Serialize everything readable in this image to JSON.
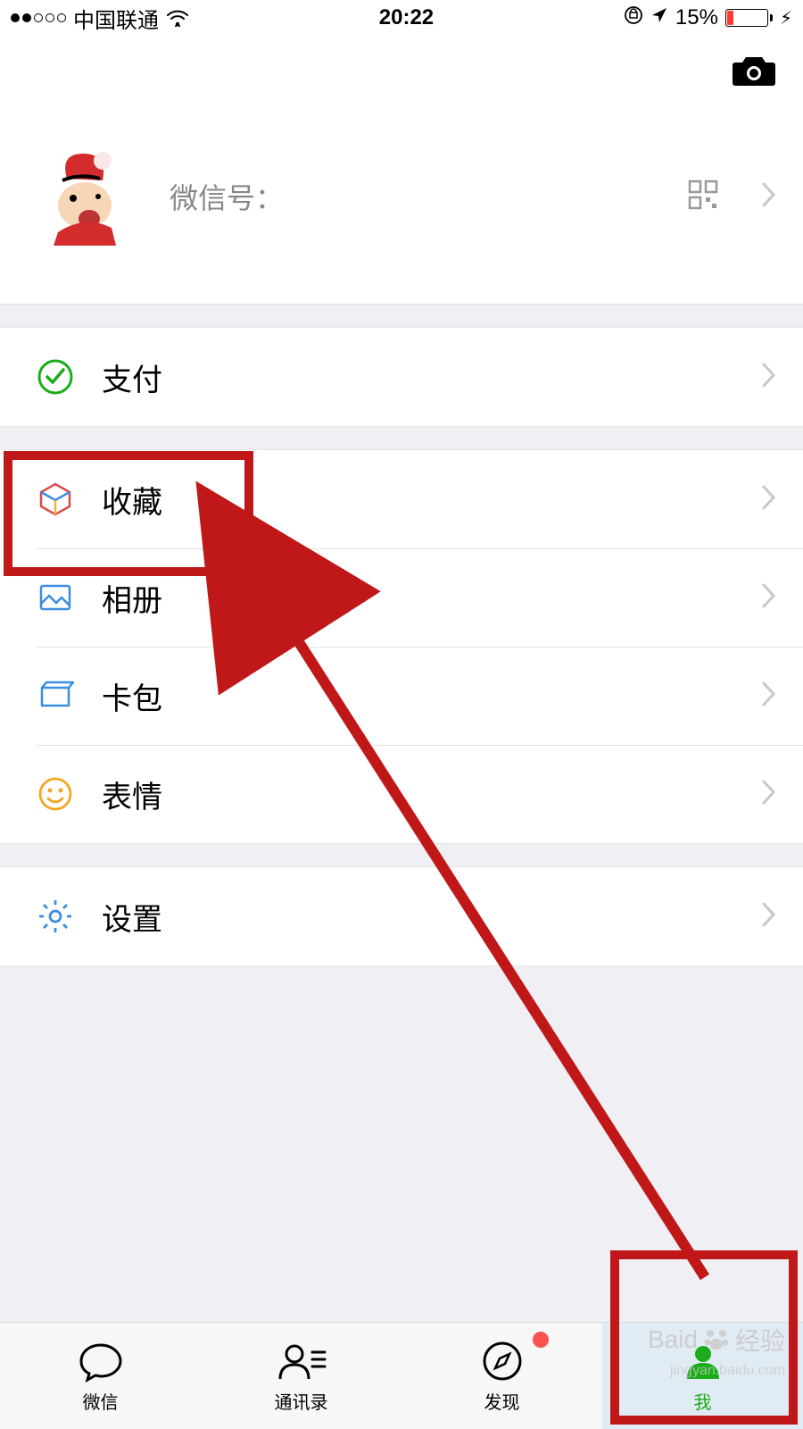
{
  "status": {
    "carrier": "中国联通",
    "time": "20:22",
    "battery_percent": "15%"
  },
  "profile": {
    "wx_id_label": "微信号："
  },
  "sections": {
    "pay": {
      "label": "支付"
    },
    "favorites": {
      "label": "收藏"
    },
    "album": {
      "label": "相册"
    },
    "cards": {
      "label": "卡包"
    },
    "stickers": {
      "label": "表情"
    },
    "settings": {
      "label": "设置"
    }
  },
  "tabs": {
    "wechat": {
      "label": "微信"
    },
    "contacts": {
      "label": "通讯录"
    },
    "discover": {
      "label": "发现"
    },
    "me": {
      "label": "我"
    }
  },
  "watermark": {
    "brand": "Baid",
    "suffix": "经验",
    "url": "jingyan.baidu.com"
  }
}
